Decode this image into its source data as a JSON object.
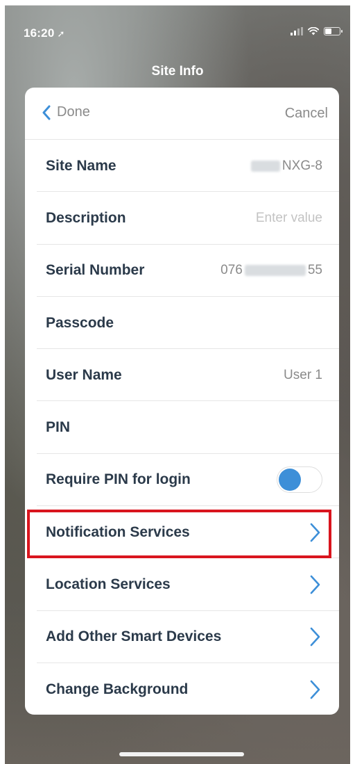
{
  "status": {
    "time": "16:20",
    "location_arrow": "➚"
  },
  "nav": {
    "title": "Site Info"
  },
  "header": {
    "done_label": "Done",
    "cancel_label": "Cancel"
  },
  "rows": {
    "site_name": {
      "label": "Site Name",
      "value": "NXG-8"
    },
    "description": {
      "label": "Description",
      "placeholder": "Enter value"
    },
    "serial_number": {
      "label": "Serial Number",
      "value_prefix": "076",
      "value_suffix": "55"
    },
    "passcode": {
      "label": "Passcode"
    },
    "user_name": {
      "label": "User Name",
      "value": "User 1"
    },
    "pin": {
      "label": "PIN"
    },
    "require_pin": {
      "label": "Require PIN for login",
      "enabled": true
    },
    "notification_services": {
      "label": "Notification Services"
    },
    "location_services": {
      "label": "Location Services"
    },
    "add_other_smart_devices": {
      "label": "Add Other Smart Devices"
    },
    "change_background": {
      "label": "Change Background"
    }
  },
  "colors": {
    "accent": "#3d8fd8",
    "label_text": "#2b3a4a",
    "secondary_text": "#8a8a8a",
    "highlight_border": "#d9151e"
  },
  "icons": {
    "back": "chevron-left-icon",
    "disclosure": "chevron-right-icon",
    "location": "location-arrow-icon",
    "signal": "cellular-signal-icon",
    "wifi": "wifi-icon",
    "battery": "battery-icon"
  }
}
